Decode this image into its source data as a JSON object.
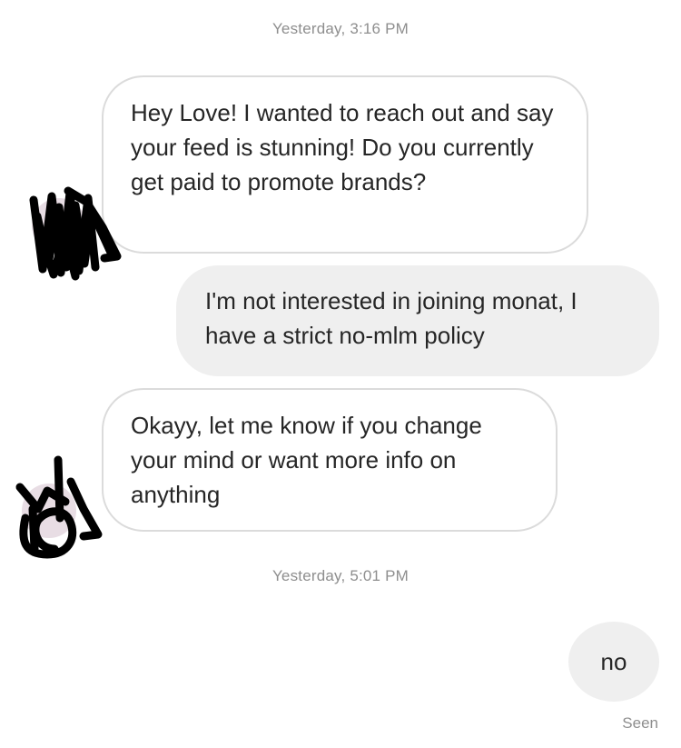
{
  "timestamps": {
    "first": "Yesterday, 3:16 PM",
    "second": "Yesterday, 5:01 PM"
  },
  "messages": [
    {
      "direction": "incoming",
      "text": "Hey Love! I wanted to reach out and say your feed is stunning! Do you currently get paid to promote brands?"
    },
    {
      "direction": "outgoing",
      "text": "I'm not interested in joining monat, I have a strict no-mlm policy"
    },
    {
      "direction": "incoming",
      "text": "Okayy, let me know if you change your mind or want more info on anything"
    },
    {
      "direction": "outgoing",
      "text": "no"
    }
  ],
  "status": {
    "seen": "Seen"
  },
  "colors": {
    "incoming_bubble_border": "#dbdbdb",
    "outgoing_bubble_bg": "#efefef",
    "text": "#262626",
    "meta_text": "#8e8e8e",
    "avatar_scribble": "#000000"
  },
  "icons": {
    "avatar_1": "scribbled-avatar-icon",
    "avatar_2": "scribbled-avatar-icon"
  }
}
